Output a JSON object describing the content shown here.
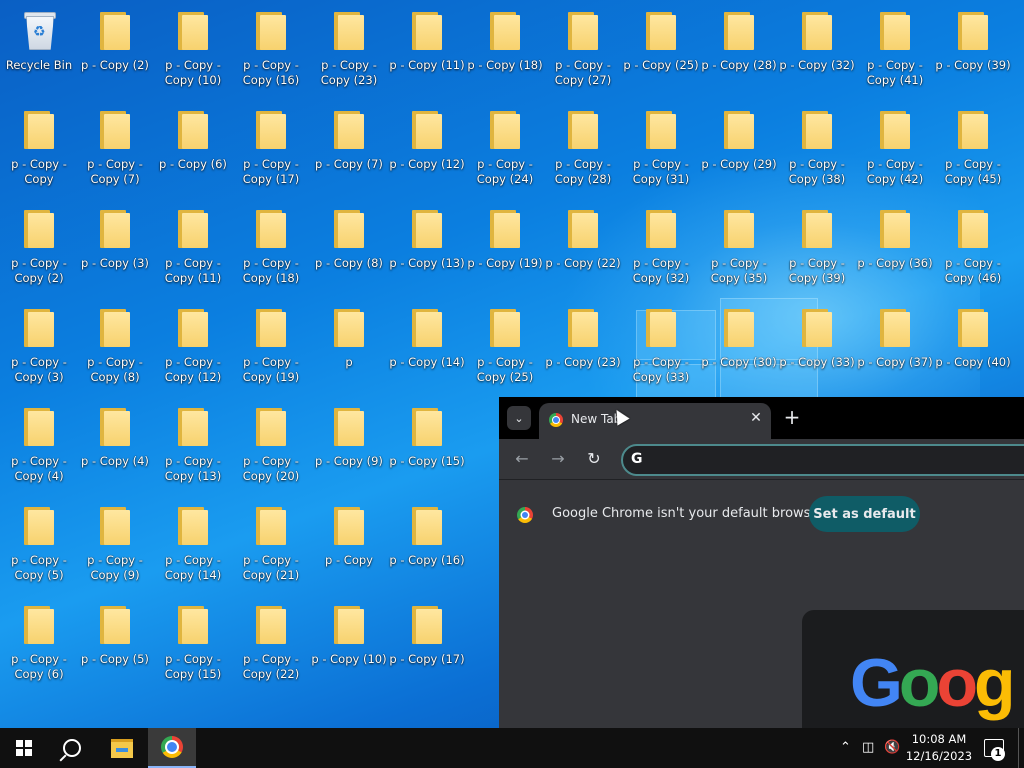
{
  "desktop": {
    "icons": [
      {
        "label": "Recycle Bin"
      },
      {
        "label": "p - Copy (2)"
      },
      {
        "label": "p - Copy - Copy (10)"
      },
      {
        "label": "p - Copy - Copy (16)"
      },
      {
        "label": "p - Copy - Copy (23)"
      },
      {
        "label": "p - Copy (11)"
      },
      {
        "label": "p - Copy (18)"
      },
      {
        "label": "p - Copy - Copy (27)"
      },
      {
        "label": "p - Copy (25)"
      },
      {
        "label": "p - Copy (28)"
      },
      {
        "label": "p - Copy (32)"
      },
      {
        "label": "p - Copy - Copy (41)"
      },
      {
        "label": "p - Copy (39)"
      },
      {
        "label": "p - Copy - Copy"
      },
      {
        "label": "p - Copy - Copy (7)"
      },
      {
        "label": "p - Copy (6)"
      },
      {
        "label": "p - Copy - Copy (17)"
      },
      {
        "label": "p - Copy (7)"
      },
      {
        "label": "p - Copy (12)"
      },
      {
        "label": "p - Copy - Copy (24)"
      },
      {
        "label": "p - Copy - Copy (28)"
      },
      {
        "label": "p - Copy - Copy (31)"
      },
      {
        "label": "p - Copy (29)"
      },
      {
        "label": "p - Copy - Copy (38)"
      },
      {
        "label": "p - Copy - Copy (42)"
      },
      {
        "label": "p - Copy - Copy (45)"
      },
      {
        "label": "p - Copy - Copy (2)"
      },
      {
        "label": "p - Copy (3)"
      },
      {
        "label": "p - Copy - Copy (11)"
      },
      {
        "label": "p - Copy - Copy (18)"
      },
      {
        "label": "p - Copy (8)"
      },
      {
        "label": "p - Copy (13)"
      },
      {
        "label": "p - Copy (19)"
      },
      {
        "label": "p - Copy (22)"
      },
      {
        "label": "p - Copy - Copy (32)"
      },
      {
        "label": "p - Copy - Copy (35)"
      },
      {
        "label": "p - Copy - Copy (39)"
      },
      {
        "label": "p - Copy (36)"
      },
      {
        "label": "p - Copy - Copy (46)"
      },
      {
        "label": "p - Copy - Copy (3)"
      },
      {
        "label": "p - Copy - Copy (8)"
      },
      {
        "label": "p - Copy - Copy (12)"
      },
      {
        "label": "p - Copy - Copy (19)"
      },
      {
        "label": "p"
      },
      {
        "label": "p - Copy (14)"
      },
      {
        "label": "p - Copy - Copy (25)"
      },
      {
        "label": "p - Copy (23)"
      },
      {
        "label": "p - Copy - Copy (33)"
      },
      {
        "label": "p - Copy (30)"
      },
      {
        "label": "p - Copy (33)"
      },
      {
        "label": "p - Copy (37)"
      },
      {
        "label": "p - Copy (40)"
      },
      {
        "label": "p - Copy - Copy (4)"
      },
      {
        "label": "p - Copy (4)"
      },
      {
        "label": "p - Copy - Copy (13)"
      },
      {
        "label": "p - Copy - Copy (20)"
      },
      {
        "label": "p - Copy (9)"
      },
      {
        "label": "p - Copy (15)"
      },
      {
        "label": "p - Copy - Copy (5)"
      },
      {
        "label": "p - Copy - Copy (9)"
      },
      {
        "label": "p - Copy - Copy (14)"
      },
      {
        "label": "p - Copy - Copy (21)"
      },
      {
        "label": "p - Copy"
      },
      {
        "label": "p - Copy (16)"
      },
      {
        "label": "p - Copy - Copy (6)"
      },
      {
        "label": "p - Copy (5)"
      },
      {
        "label": "p - Copy - Copy (15)"
      },
      {
        "label": "p - Copy - Copy (22)"
      },
      {
        "label": "p - Copy (10)"
      },
      {
        "label": "p - Copy (17)"
      }
    ]
  },
  "chrome": {
    "tab_title": "New Tab",
    "tab_close": "✕",
    "new_tab": "+",
    "back": "←",
    "forward": "→",
    "reload": "↻",
    "omnibox_icon": "G",
    "infobar_message": "Google Chrome isn't your default browser",
    "set_default_label": "Set as default",
    "doodle_text": "Goog"
  },
  "taskbar": {
    "time": "10:08 AM",
    "date": "12/16/2023",
    "notification_count": "1"
  }
}
